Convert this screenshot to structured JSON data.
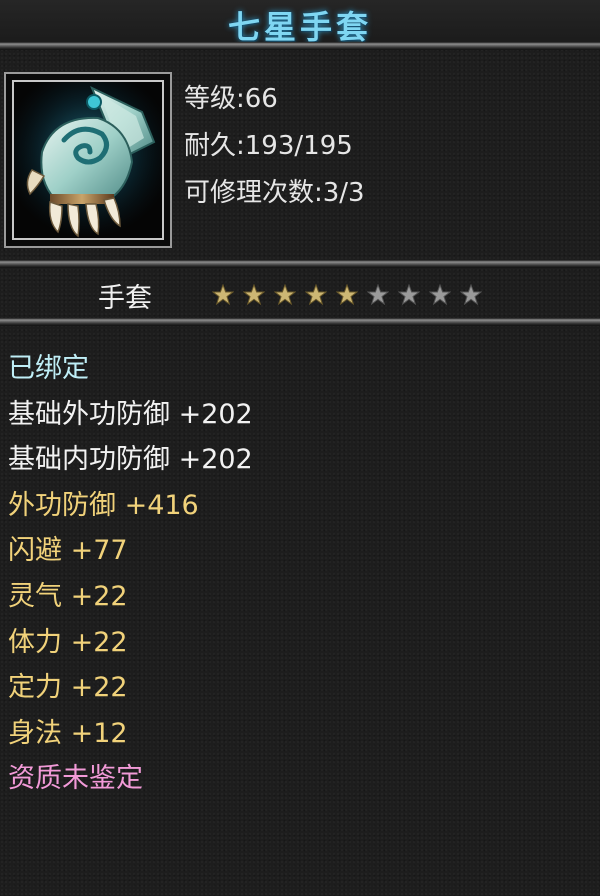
{
  "item": {
    "name": "七星手套",
    "icon": "gauntlet-icon",
    "stats": [
      "等级:66",
      "耐久:193/195",
      "可修理次数:3/3"
    ],
    "type_label": "手套",
    "stars": {
      "filled": 5,
      "total": 9
    },
    "bound_status": "已绑定",
    "base_attributes": [
      "基础外功防御 +202",
      "基础内功防御 +202"
    ],
    "extra_attributes": [
      "外功防御 +416",
      "闪避 +77",
      "灵气 +22",
      "体力 +22",
      "定力 +22",
      "身法 +12"
    ],
    "quality_status": "资质未鉴定"
  },
  "colors": {
    "title": "#7fd6f2",
    "bound": "#bfeef6",
    "base_attribute": "#f2f2f2",
    "extra_attribute": "#f1d27a",
    "quality": "#f29ad8",
    "star_filled": "#cdb774",
    "star_empty": "#9a9a9a"
  }
}
